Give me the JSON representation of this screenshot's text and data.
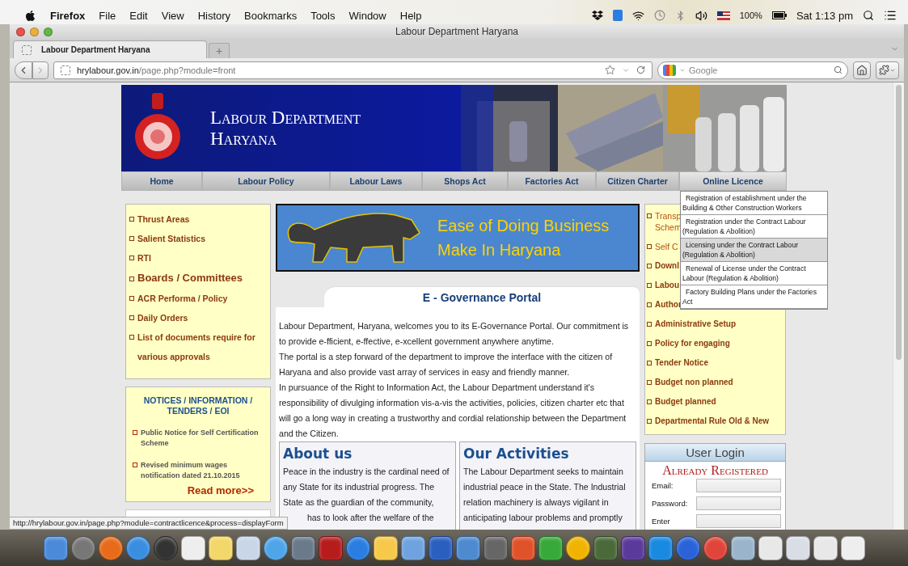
{
  "menu_bar": {
    "app": "Firefox",
    "items": [
      "File",
      "Edit",
      "View",
      "History",
      "Bookmarks",
      "Tools",
      "Window",
      "Help"
    ],
    "battery": "100%",
    "clock": "Sat 1:13 pm"
  },
  "window": {
    "title": "Labour Department Haryana"
  },
  "tabs": [
    {
      "label": "Labour Department Haryana",
      "selected": true
    }
  ],
  "new_tab": "+",
  "address_bar": {
    "host": "hrylabour.gov.in",
    "path": "/page.php?module=front"
  },
  "search": {
    "placeholder": "Google"
  },
  "banner": {
    "title_1": "Labour Department",
    "title_2": "Haryana"
  },
  "nav": [
    {
      "label": "Home",
      "open": false
    },
    {
      "label": "Labour Policy",
      "open": false
    },
    {
      "label": "Labour Laws",
      "open": false
    },
    {
      "label": "Shops Act",
      "open": false
    },
    {
      "label": "Factories Act",
      "open": false
    },
    {
      "label": "Citizen Charter",
      "open": false
    },
    {
      "label": "Online Licence",
      "open": true
    }
  ],
  "dropdown": [
    {
      "label": "Registration of establishment under the Building & Other Construction Workers",
      "selected": false
    },
    {
      "label": "Registration under the Contract Labour (Regulation & Abolition)",
      "selected": false
    },
    {
      "label": "Licensing under the Contract Labour (Regulation & Abolition)",
      "selected": true
    },
    {
      "label": "Renewal of License under the Contract Labour (Regulation & Abolition)",
      "selected": false
    },
    {
      "label": "Factory Building Plans under the Factories Act",
      "selected": false
    }
  ],
  "left_links": [
    {
      "label": "Thrust Areas",
      "kind": "normal"
    },
    {
      "label": "Salient Statistics",
      "kind": "normal"
    },
    {
      "label": "RTI",
      "kind": "normal"
    },
    {
      "label": "Boards / Committees",
      "kind": "large"
    },
    {
      "label": "ACR Performa / Policy",
      "kind": "normal"
    },
    {
      "label": "Daily Orders",
      "kind": "normal"
    },
    {
      "label": "List of documents require for various approvals",
      "kind": "normal"
    }
  ],
  "notices": {
    "title": "NOTICES / INFORMATION / TENDERS / EOI",
    "items": [
      "Public Notice for Self Certification Scheme",
      "Revised minimum wages notification dated 21.10.2015"
    ],
    "more": "Read more>>"
  },
  "promo": {
    "line_1": "Ease of Doing Business",
    "line_2": "Make In Haryana"
  },
  "portal": {
    "title": "E - Governance Portal",
    "paragraphs": [
      "Labour Department, Haryana, welcomes you to its E-Governance Portal. Our commitment is to provide e-fficient, e-ffective, e-xcellent government anywhere anytime.",
      "The portal is a step forward of the department to improve the interface with the citizen of Haryana and also provide vast array of services in easy and friendly manner.",
      "In pursuance of the Right to Information Act, the Labour Department understand it's responsibility of divulging information vis-a-vis the activities, policies, citizen charter etc that will go a long way in creating a trustworthy and cordial relationship between the Department and the Citizen."
    ]
  },
  "cards": [
    {
      "title": "About us",
      "text": "Peace in the industry is the cardinal need of any State for its industrial progress. The State as the guardian of the community,",
      "text_after": "has to look after the welfare of the"
    },
    {
      "title": "Our Activities",
      "text": "The Labour Department seeks to maintain industrial peace in the State. The Industrial relation machinery is always vigilant in anticipating labour problems and promptly"
    }
  ],
  "right_links": [
    {
      "label": "Transp\nSchem",
      "kind": "plain"
    },
    {
      "label": "Self C",
      "kind": "plain"
    },
    {
      "label": "Downl",
      "kind": "bold"
    },
    {
      "label": "Labou",
      "kind": "bold"
    },
    {
      "label": "Author",
      "kind": "bold"
    },
    {
      "label": "Administrative Setup",
      "kind": "bold"
    },
    {
      "label": "Policy for engaging",
      "kind": "bold"
    },
    {
      "label": "Tender Notice",
      "kind": "bold"
    },
    {
      "label": "Budget non planned",
      "kind": "bold"
    },
    {
      "label": "Budget planned",
      "kind": "bold"
    },
    {
      "label": "Departmental Rule Old & New",
      "kind": "bold"
    }
  ],
  "login": {
    "title": "User Login",
    "subtitle": "Already Registered",
    "fields": [
      {
        "label": "Email:"
      },
      {
        "label": "Password:"
      },
      {
        "label": "Enter"
      }
    ]
  },
  "status_bar": "http://hrylabour.gov.in/page.php?module=contractlicence&process=displayForm"
}
